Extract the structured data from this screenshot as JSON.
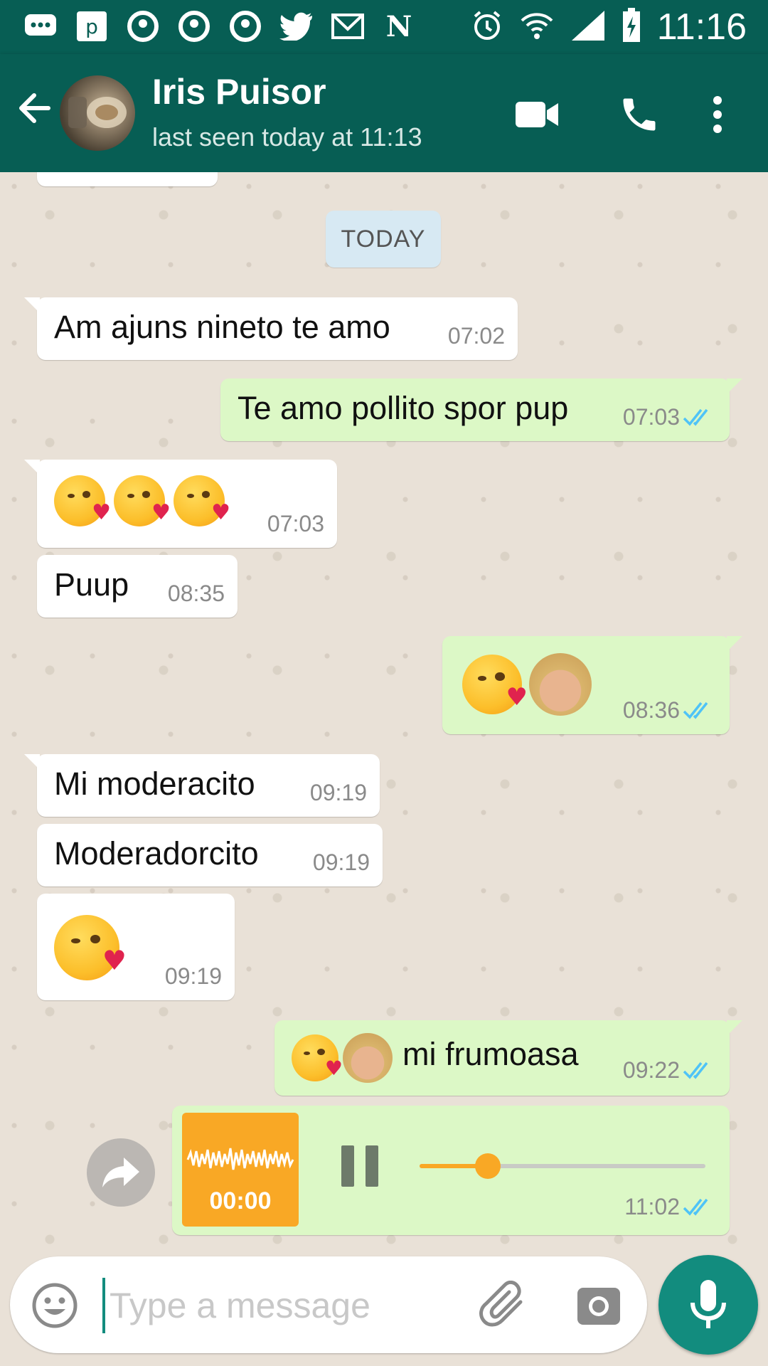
{
  "status_bar": {
    "time": "11:16",
    "icons": [
      "message-icon",
      "p-app-icon",
      "notification-icon",
      "notification-icon",
      "notification-icon",
      "twitter-icon",
      "email-icon",
      "n-app-icon",
      "alarm-icon",
      "wifi-icon",
      "signal-icon",
      "battery-charging-icon"
    ]
  },
  "header": {
    "contact_name": "Iris Puisor",
    "last_seen": "last seen today at 11:13",
    "icons": [
      "back-arrow-icon",
      "video-call-icon",
      "phone-icon",
      "more-options-icon"
    ]
  },
  "chat": {
    "date_label": "TODAY",
    "messages": [
      {
        "dir": "in",
        "text": "Am ajuns nineto te amo",
        "time": "07:02"
      },
      {
        "dir": "out",
        "text": "Te amo pollito spor pup",
        "time": "07:03",
        "status": "read"
      },
      {
        "dir": "in",
        "emoji": "kissing-heart-face x3",
        "time": "07:03"
      },
      {
        "dir": "in",
        "text": "Puup",
        "time": "08:35"
      },
      {
        "dir": "out",
        "emoji": "kissing-heart-face + woman-blond-hair",
        "time": "08:36",
        "status": "read"
      },
      {
        "dir": "in",
        "text": "Mi moderacito",
        "time": "09:19"
      },
      {
        "dir": "in",
        "text": "Moderadorcito",
        "time": "09:19"
      },
      {
        "dir": "in",
        "emoji": "kissing-heart-face",
        "time": "09:19"
      },
      {
        "dir": "out",
        "text": "mi frumoasa",
        "time": "09:22",
        "status": "read"
      },
      {
        "dir": "out",
        "type": "voice",
        "audio_elapsed": "00:00",
        "progress": 0.24,
        "time": "11:02",
        "status": "read"
      }
    ]
  },
  "composer": {
    "placeholder": "Type a message",
    "icons": [
      "emoji-icon",
      "attach-icon",
      "camera-icon",
      "microphone-icon"
    ]
  },
  "colors": {
    "header": "#075e54",
    "outgoing_bubble": "#dcf8c6",
    "incoming_bubble": "#ffffff",
    "read_ticks": "#4fc3f7",
    "accent": "#128c7e",
    "audio_accent": "#f9a825"
  }
}
